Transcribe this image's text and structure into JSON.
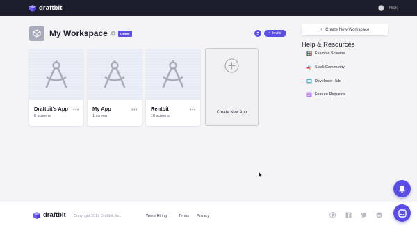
{
  "topbar": {
    "brand": "draftbit",
    "user_name": "Nick"
  },
  "workspace": {
    "title": "My Workspace",
    "badge": "Owner",
    "invite_label": "Invite"
  },
  "apps": [
    {
      "name": "Draftbit's App",
      "screens": "6 screens"
    },
    {
      "name": "My App",
      "screens": "1 screen"
    },
    {
      "name": "Rentbit",
      "screens": "10 screens"
    }
  ],
  "create_app_label": "Create New App",
  "sidebar": {
    "new_workspace_label": "Create New Workspace",
    "help_title": "Help & Resources",
    "items": [
      {
        "label": "Example Screens",
        "icon": "example-screens-icon"
      },
      {
        "label": "Slack Community",
        "icon": "slack-icon"
      },
      {
        "label": "Developer Hub",
        "icon": "developer-hub-icon"
      },
      {
        "label": "Feature Requests",
        "icon": "feature-requests-icon"
      }
    ]
  },
  "footer": {
    "brand": "draftbit",
    "copyright": "Copyright 2019 Draftbit, Inc.",
    "links": [
      "We're Hiring!",
      "Terms",
      "Privacy"
    ],
    "social": [
      "github-icon",
      "facebook-icon",
      "twitter-icon",
      "reddit-icon"
    ]
  },
  "colors": {
    "accent": "#5a4ee6",
    "topbar": "#1c1e2b",
    "background": "#f4f4f7"
  }
}
